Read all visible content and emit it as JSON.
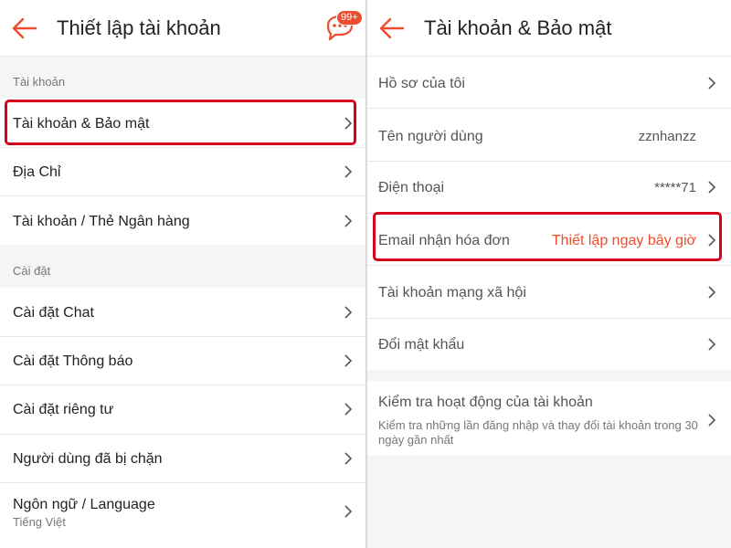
{
  "left": {
    "header": {
      "title": "Thiết lập tài khoản",
      "badge": "99+"
    },
    "sections": [
      {
        "label": "Tài khoản"
      },
      {
        "label": "Cài đặt"
      }
    ],
    "items": [
      {
        "label": "Tài khoản & Bảo mật"
      },
      {
        "label": "Địa Chỉ"
      },
      {
        "label": "Tài khoản / Thẻ Ngân hàng"
      },
      {
        "label": "Cài đặt Chat"
      },
      {
        "label": "Cài đặt Thông báo"
      },
      {
        "label": "Cài đặt riêng tư"
      },
      {
        "label": "Người dùng đã bị chặn"
      },
      {
        "label": "Ngôn ngữ / Language",
        "sub": "Tiếng Việt"
      }
    ]
  },
  "right": {
    "header": {
      "title": "Tài khoản & Bảo mật"
    },
    "items": [
      {
        "label": "Hồ sơ của tôi"
      },
      {
        "label": "Tên người dùng",
        "value": "zznhanzz"
      },
      {
        "label": "Điện thoại",
        "value": "*****71"
      },
      {
        "label": "Email nhận hóa đơn",
        "value": "Thiết lập ngay bây giờ"
      },
      {
        "label": "Tài khoản mạng xã hội"
      },
      {
        "label": "Đổi mật khẩu"
      },
      {
        "label": "Kiểm tra hoạt động của tài khoản",
        "sub": "Kiểm tra những lần đăng nhập và thay đổi tài khoản trong 30 ngày gần nhất"
      }
    ]
  },
  "colors": {
    "accent": "#ee4d2d",
    "highlight": "#d6001c"
  }
}
